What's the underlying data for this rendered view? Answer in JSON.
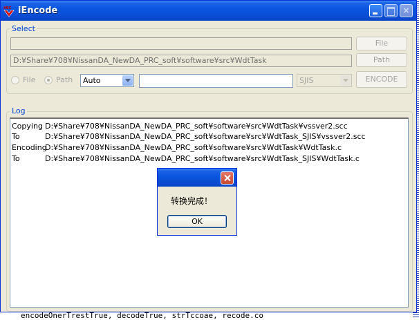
{
  "window": {
    "title": "iEncode"
  },
  "select_group": {
    "label": "Select",
    "file_field_value": "",
    "path_field_value": "D:¥Share¥708¥NissanDA_NewDA_PRC_soft¥software¥src¥WdtTask",
    "file_button": "File",
    "path_button": "Path",
    "encode_button": "ENCODE",
    "radio_file": "File",
    "radio_path": "Path",
    "source_encoding": "Auto",
    "target_input_value": "",
    "target_encoding": "SJIS"
  },
  "log_group": {
    "label": "Log",
    "rows": [
      {
        "key": "Copying",
        "value": "D:¥Share¥708¥NissanDA_NewDA_PRC_soft¥software¥src¥WdtTask¥vssver2.scc"
      },
      {
        "key": "To",
        "value": "D:¥Share¥708¥NissanDA_NewDA_PRC_soft¥software¥src¥WdtTask_SJIS¥vssver2.scc"
      },
      {
        "key": "Encoding",
        "value": "D:¥Share¥708¥NissanDA_NewDA_PRC_soft¥software¥src¥WdtTask¥WdtTask.c"
      },
      {
        "key": "To",
        "value": "D:¥Share¥708¥NissanDA_NewDA_PRC_soft¥software¥src¥WdtTask_SJIS¥WdtTask.c"
      }
    ]
  },
  "dialog": {
    "message": "转换完成！",
    "ok_label": "OK"
  },
  "background": {
    "bottom_text": "encodeOnerTrestTrue, decodeTrue, strTccoae, recode.co"
  },
  "colors": {
    "titlebar": "#0a56e0",
    "group_label": "#0046d5",
    "window_bg": "#ece9d8"
  }
}
